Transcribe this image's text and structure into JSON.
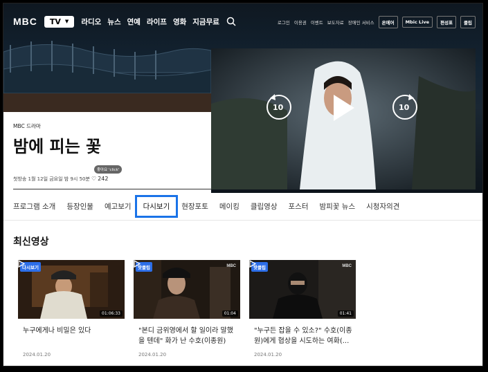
{
  "header": {
    "logo": "MBC",
    "channel_select": "TV",
    "menu": [
      "라디오",
      "뉴스",
      "연예",
      "라이프",
      "영화",
      "지금무료"
    ],
    "utility_links": [
      "로그인",
      "이용권",
      "이벤트",
      "보도자료",
      "장애인 서비스"
    ],
    "utility_buttons": [
      "온에어",
      "Mbic Live",
      "편성표",
      "클립"
    ]
  },
  "program": {
    "brand": "MBC 드라마",
    "title": "밤에 피는 꽃",
    "airtime": "첫방송 1월 12일 금요일 밤 9시 50분",
    "like_tooltip": "좋아요 'click'",
    "like_count": "242"
  },
  "player": {
    "rewind_label": "10",
    "forward_label": "10"
  },
  "tabs": [
    "프로그램 소개",
    "등장인물",
    "예고보기",
    "다시보기",
    "현장포토",
    "메이킹",
    "클립영상",
    "포스터",
    "밤피꽃 뉴스",
    "시청자의견"
  ],
  "active_tab": "다시보기",
  "latest": {
    "heading": "최신영상",
    "videos": [
      {
        "badge": "다시보기",
        "duration": "01:06:33",
        "title": "누구에게나 비밀은 있다",
        "date": "2024.01.20",
        "mark": ""
      },
      {
        "badge": "핫클립",
        "duration": "01:04",
        "title": "\"본디 금위영에서 할 일이라 말했을 텐데\" 화가 난 수호(이종원)",
        "date": "2024.01.20",
        "mark": "MBC"
      },
      {
        "badge": "핫클립",
        "duration": "01:41",
        "title": "\"누구든 잡을 수 있소?\" 수호(이종원)에게 협상을 시도하는 여화(...",
        "date": "2024.01.20",
        "mark": "MBC"
      }
    ]
  },
  "colors": {
    "accent": "#1a73e8",
    "badge": "#2c6ee8"
  }
}
